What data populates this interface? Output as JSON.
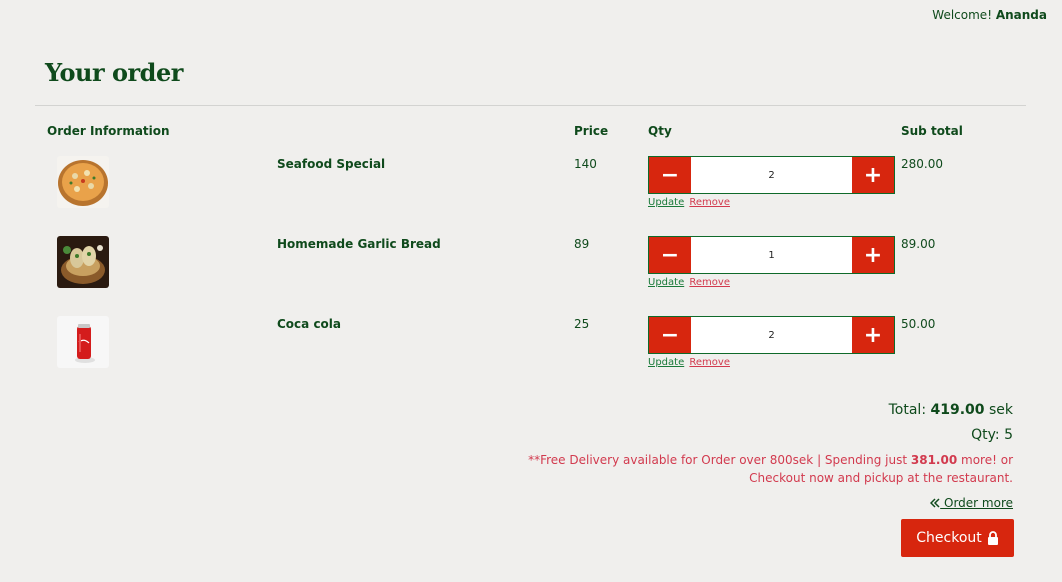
{
  "header": {
    "welcome_prefix": "Welcome!",
    "user_name": "Ananda"
  },
  "page_title": "Your order",
  "table": {
    "columns": {
      "info": "Order Information",
      "price": "Price",
      "qty": "Qty",
      "subtotal": "Sub total"
    },
    "rows": [
      {
        "name": "Seafood Special",
        "price": "140",
        "qty": "2",
        "subtotal": "280.00",
        "image": "pizza-image"
      },
      {
        "name": "Homemade Garlic Bread",
        "price": "89",
        "qty": "1",
        "subtotal": "89.00",
        "image": "garlic-bread-image"
      },
      {
        "name": "Coca cola",
        "price": "25",
        "qty": "2",
        "subtotal": "50.00",
        "image": "coca-cola-image"
      }
    ],
    "update_label": "Update",
    "remove_label": "Remove",
    "minus_icon": "−",
    "plus_icon": "+"
  },
  "summary": {
    "total_label": "Total:",
    "total_value": "419.00",
    "total_currency": "sek",
    "qty_label": "Qty:",
    "qty_value": "5",
    "notice_prefix": "**Free Delivery available for Order over 800sek | Spending just",
    "notice_amount": "381.00",
    "notice_suffix": "more! or",
    "notice_line2": "Checkout now and pickup at the restaurant.",
    "order_more_label": "Order more",
    "checkout_label": "Checkout"
  },
  "colors": {
    "primary_green": "#0f4a1c",
    "accent_red": "#d7260e",
    "notice_red": "#d23a4e",
    "background": "#f0efed"
  }
}
